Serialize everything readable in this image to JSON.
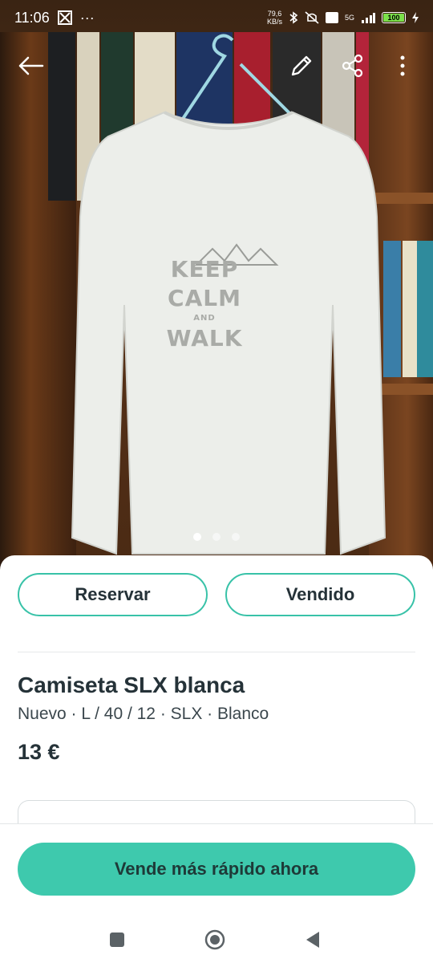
{
  "status_bar": {
    "time": "11:06",
    "net_speed_value": "79,6",
    "net_speed_unit": "KB/s",
    "signal": "5G",
    "battery": "100"
  },
  "toolbar": {
    "back_icon": "arrow-left-icon",
    "edit_icon": "pencil-icon",
    "share_icon": "share-icon",
    "more_icon": "more-vertical-icon"
  },
  "photo": {
    "shirt_print_lines": [
      "KEEP",
      "CALM",
      "AND",
      "WALK"
    ],
    "current_page": 1,
    "total_pages": 3
  },
  "actions": {
    "reserve": "Reservar",
    "sold": "Vendido"
  },
  "product": {
    "title": "Camiseta SLX blanca",
    "attributes": "Nuevo · L / 40 / 12 · SLX · Blanco",
    "price": "13 €"
  },
  "cta": {
    "label": "Vende más rápido ahora"
  },
  "colors": {
    "accent": "#3ec9ad",
    "outline": "#38c2a8",
    "text": "#253238"
  },
  "navbar": {
    "recents_icon": "square-icon",
    "home_icon": "circle-home-icon",
    "back_icon": "triangle-back-icon"
  }
}
